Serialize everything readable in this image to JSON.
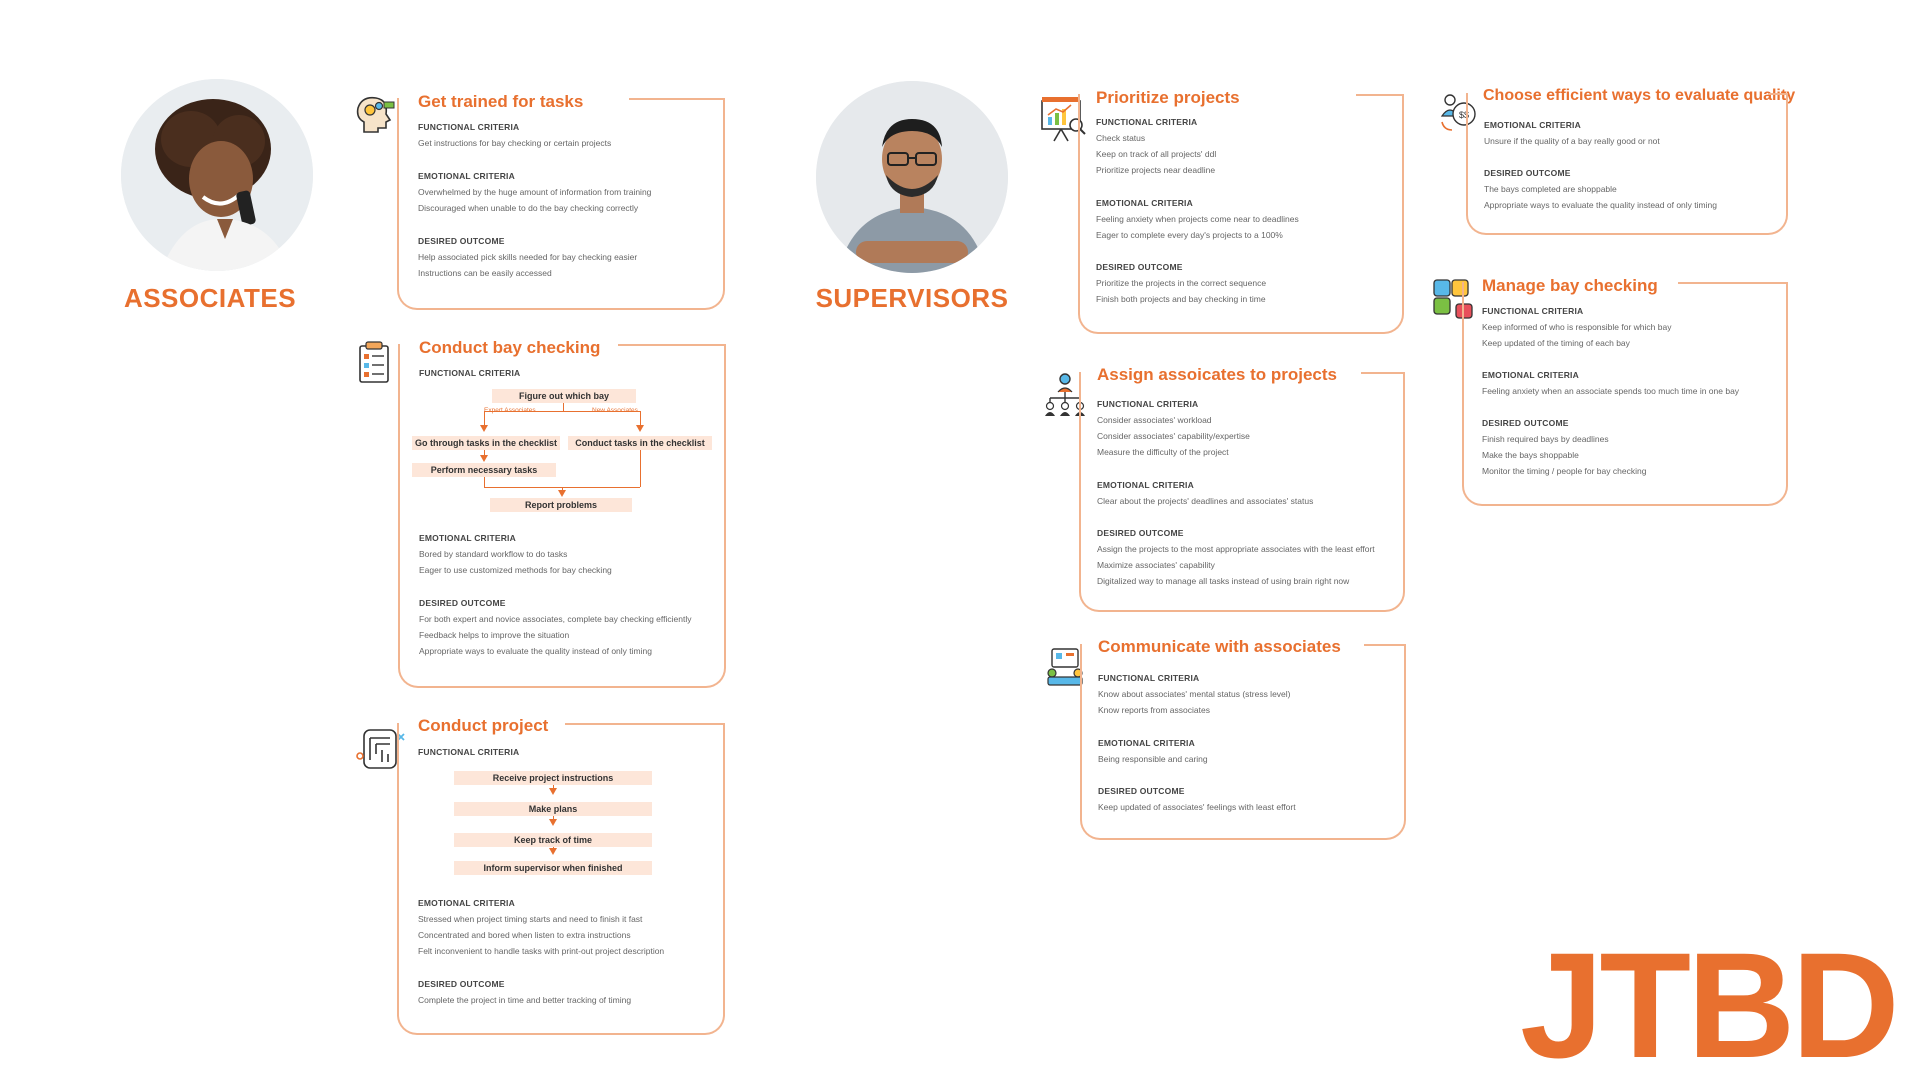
{
  "personas": {
    "associates": "ASSOCIATES",
    "supervisors": "SUPERVISORS"
  },
  "brand": "JTBD",
  "colors": {
    "accent": "#e8702f",
    "border": "#f2b48f",
    "flow_box": "#fde6d9"
  },
  "cards": {
    "get_trained": {
      "title": "Get trained for tasks",
      "icon": "head-gears-icon",
      "s1": "FUNCTIONAL CRITERIA",
      "f": [
        "Get instructions for bay checking or certain projects"
      ],
      "s2": "EMOTIONAL CRITERIA",
      "e": [
        "Overwhelmed by the huge amount of information from training",
        "Discouraged when unable to do the bay checking correctly"
      ],
      "s3": "DESIRED OUTCOME",
      "d": [
        "Help associated pick skills needed for bay checking easier",
        "Instructions can be easily accessed"
      ]
    },
    "conduct_bay": {
      "title": "Conduct bay checking",
      "icon": "checklist-icon",
      "s1": "FUNCTIONAL CRITERIA",
      "flow": {
        "top": "Figure out which bay",
        "left_label": "Expert Associates",
        "right_label": "New Associates",
        "left1": "Go through tasks in the checklist",
        "right1": "Conduct tasks in the checklist",
        "left2": "Perform necessary tasks",
        "bottom": "Report problems"
      },
      "s2": "EMOTIONAL CRITERIA",
      "e": [
        "Bored by standard workflow to do tasks",
        "Eager to use customized methods for bay checking"
      ],
      "s3": "DESIRED OUTCOME",
      "d": [
        "For both expert and novice associates, complete bay checking efficiently",
        "Feedback helps to improve the situation",
        "Appropriate ways to evaluate the quality instead of only timing"
      ]
    },
    "conduct_project": {
      "title": "Conduct project",
      "icon": "maze-icon",
      "s1": "FUNCTIONAL CRITERIA",
      "flow": [
        "Receive project instructions",
        "Make plans",
        "Keep track of time",
        "Inform supervisor when finished"
      ],
      "s2": "EMOTIONAL CRITERIA",
      "e": [
        "Stressed when project timing starts and need to finish it fast",
        "Concentrated and bored when listen to extra instructions",
        "Felt inconvenient to handle tasks with print-out project description"
      ],
      "s3": "DESIRED OUTCOME",
      "d": [
        "Complete the project in time and better tracking of timing"
      ]
    },
    "prioritize": {
      "title": "Prioritize projects",
      "icon": "chart-board-icon",
      "s1": "FUNCTIONAL CRITERIA",
      "f": [
        "Check status",
        "Keep on track of all projects' ddl",
        "Prioritize projects near deadline"
      ],
      "s2": "EMOTIONAL CRITERIA",
      "e": [
        "Feeling anxiety when projects come near to deadlines",
        "Eager to complete every day's projects to a 100%"
      ],
      "s3": "DESIRED OUTCOME",
      "d": [
        "Prioritize the projects in the correct sequence",
        "Finish both projects and bay checking in time"
      ]
    },
    "assign": {
      "title": "Assign assoicates to projects",
      "icon": "org-chart-icon",
      "s1": "FUNCTIONAL CRITERIA",
      "f": [
        "Consider associates' workload",
        "Consider associates' capability/expertise",
        "Measure the difficulty of the project"
      ],
      "s2": "EMOTIONAL CRITERIA",
      "e": [
        "Clear about the projects' deadlines and associates' status"
      ],
      "s3": "DESIRED OUTCOME",
      "d": [
        "Assign the projects to the most appropriate associates with the least effort",
        "Maximize associates' capability",
        "Digitalized way to manage all tasks instead of using brain right now"
      ]
    },
    "communicate": {
      "title": "Communicate with associates",
      "icon": "meeting-icon",
      "s1": "FUNCTIONAL CRITERIA",
      "f": [
        "Know about associates' mental status (stress level)",
        "Know reports from associates"
      ],
      "s2": "EMOTIONAL CRITERIA",
      "e": [
        "Being responsible and caring"
      ],
      "s3": "DESIRED OUTCOME",
      "d": [
        "Keep updated of associates' feelings with least effort"
      ]
    },
    "evaluate": {
      "title": "Choose efficient ways to evaluate quality",
      "icon": "quality-badge-icon",
      "s1": "EMOTIONAL CRITERIA",
      "e": [
        "Unsure if the quality of a bay really good or not"
      ],
      "s2": "DESIRED OUTCOME",
      "d": [
        "The bays completed are shoppable",
        "Appropriate ways to evaluate the quality instead of only timing"
      ]
    },
    "manage": {
      "title": "Manage bay checking",
      "icon": "puzzle-icon",
      "s1": "FUNCTIONAL CRITERIA",
      "f": [
        "Keep informed of who is responsible for which bay",
        "Keep updated of the timing of each bay"
      ],
      "s2": "EMOTIONAL CRITERIA",
      "e": [
        "Feeling anxiety when an associate spends too much time in one bay"
      ],
      "s3": "DESIRED OUTCOME",
      "d": [
        "Finish required bays by deadlines",
        "Make the bays shoppable",
        "Monitor the timing / people for bay checking"
      ]
    }
  }
}
